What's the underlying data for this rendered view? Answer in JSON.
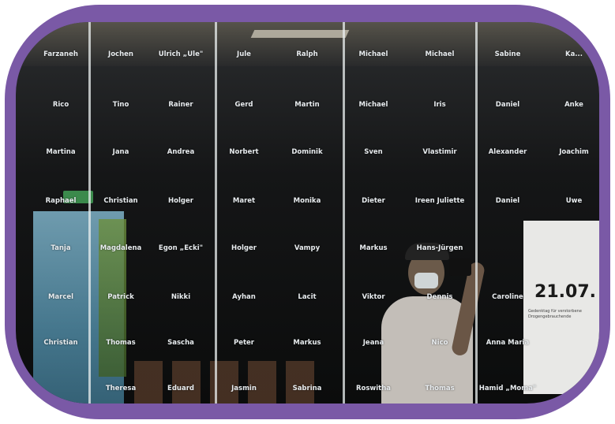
{
  "photo": {
    "whiteboard_date": "21.07.",
    "whiteboard_text": "Gedenktag für verstorbene Drogengebrauchende"
  },
  "names": [
    [
      "Farzaneh",
      "Jochen",
      "Ulrich „Ule\"",
      "Jule",
      "Ralph",
      "Michael",
      "Michael",
      "Sabine",
      "Ka..."
    ],
    [
      "Rico",
      "Tino",
      "Rainer",
      "Gerd",
      "Martin",
      "Michael",
      "Iris",
      "Daniel",
      "Anke"
    ],
    [
      "Martina",
      "Jana",
      "Andrea",
      "Norbert",
      "Dominik",
      "Sven",
      "Vlastimir",
      "Alexander",
      "Joachim"
    ],
    [
      "Raphael",
      "Christian",
      "Holger",
      "Maret",
      "Monika",
      "Dieter",
      "Ireen Juliette",
      "Daniel",
      "Uwe"
    ],
    [
      "Tanja",
      "Magdalena",
      "Egon „Ecki\"",
      "Holger",
      "Vampy",
      "Markus",
      "Hans-Jürgen",
      "",
      ""
    ],
    [
      "Marcel",
      "Patrick",
      "Nikki",
      "Ayhan",
      "Lacit",
      "Viktor",
      "Dennis",
      "Caroline",
      ""
    ],
    [
      "Christian",
      "Thomas",
      "Sascha",
      "Peter",
      "Markus",
      "Jeana",
      "Nico",
      "Anna Maria",
      ""
    ],
    [
      "",
      "Theresa",
      "Eduard",
      "Jasmin",
      "Sabrina",
      "Roswitha",
      "Thomas",
      "Hamid „Moma\"",
      ""
    ]
  ]
}
